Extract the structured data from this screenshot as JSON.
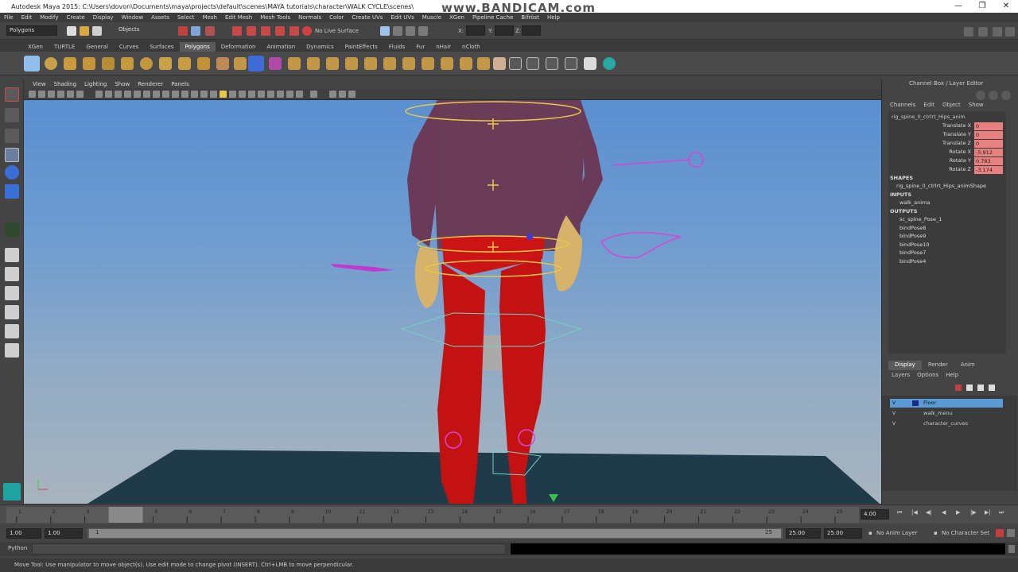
{
  "titlebar": {
    "title": "Autodesk Maya 2015: C:\\Users\\dovon\\Documents\\maya\\projects\\default\\scenes\\MAYA tutorials\\character\\WALK CYCLE\\scenes\\character*",
    "watermark": "www.BANDICAM.com",
    "minimize": "—",
    "maximize": "❐",
    "close": "✕"
  },
  "menubar": [
    "File",
    "Edit",
    "Modify",
    "Create",
    "Display",
    "Window",
    "Assets",
    "Select",
    "Mesh",
    "Edit Mesh",
    "Mesh Tools",
    "Normals",
    "Color",
    "Create UVs",
    "Edit UVs",
    "Muscle",
    "XGen",
    "Pipeline Cache",
    "Bifröst",
    "Help"
  ],
  "statusline": {
    "mode_menu": "Polygons",
    "select_mode": "Objects",
    "live_surface": "No Live Surface",
    "coord_labels": [
      "X:",
      "Y:",
      "Z:"
    ]
  },
  "shelf_tabs": [
    "XGen",
    "TURTLE",
    "General",
    "Curves",
    "Surfaces",
    "Polygons",
    "Deformation",
    "Animation",
    "Dynamics",
    "PaintEffects",
    "Fluids",
    "Fur",
    "nHair",
    "nCloth"
  ],
  "active_shelf_tab": "Polygons",
  "panel_menu": [
    "View",
    "Shading",
    "Lighting",
    "Show",
    "Renderer",
    "Panels"
  ],
  "channel_box": {
    "header": "Channel Box / Layer Editor",
    "menu": [
      "Channels",
      "Edit",
      "Object",
      "Show"
    ],
    "object_name": "rig_spine_0_ctrlrt_Hips_anim",
    "attributes": [
      {
        "name": "Translate X",
        "value": "0"
      },
      {
        "name": "Translate Y",
        "value": "0"
      },
      {
        "name": "Translate Z",
        "value": "0"
      },
      {
        "name": "Rotate X",
        "value": "-5.912"
      },
      {
        "name": "Rotate Y",
        "value": "0.783"
      },
      {
        "name": "Rotate Z",
        "value": "-3.174"
      }
    ],
    "shapes_heading": "SHAPES",
    "shape_name": "rig_spine_0_ctrlrt_Hips_animShape",
    "inputs_heading": "INPUTS",
    "inputs": [
      "walk_anima"
    ],
    "outputs_heading": "OUTPUTS",
    "outputs": [
      "sc_spine_Pose_1",
      "bindPose8",
      "bindPose9",
      "bindPose10",
      "bindPose7",
      "bindPose4"
    ]
  },
  "layer_editor": {
    "tabs": [
      "Display",
      "Render",
      "Anim"
    ],
    "active_tab": "Display",
    "menu": [
      "Layers",
      "Options",
      "Help"
    ],
    "layers": [
      {
        "name": "Floor",
        "selected": true
      },
      {
        "name": "walk_menu",
        "selected": false
      },
      {
        "name": "character_curves",
        "selected": false
      }
    ]
  },
  "timeline": {
    "start": 1,
    "end": 25,
    "ticks": [
      "1",
      "2",
      "3",
      "4",
      "5",
      "6",
      "7",
      "8",
      "9",
      "10",
      "11",
      "12",
      "13",
      "14",
      "15",
      "16",
      "17",
      "18",
      "19",
      "20",
      "21",
      "22",
      "23",
      "24",
      "25"
    ],
    "current_frame": 4,
    "current_frame_field": "4.00"
  },
  "range": {
    "start_field": "1.00",
    "start_inner": "1.00",
    "range_start_label": "1",
    "range_end_label": "25",
    "end_inner": "25.00",
    "end_field": "25.00",
    "anim_layer": "No Anim Layer",
    "character_set": "No Character Set"
  },
  "cmdline": {
    "label": "Python"
  },
  "helpline": {
    "text": "Move Tool: Use manipulator to move object(s). Use edit mode to change pivot (INSERT). Ctrl+LMB to move perpendicular."
  },
  "colors": {
    "accent_tab": "#5a5a5a",
    "key_attr": "#e98080",
    "layer_selected": "#5b9bd5",
    "viewport_top": "#5a8fd0",
    "viewport_bottom": "#a8b4be"
  }
}
